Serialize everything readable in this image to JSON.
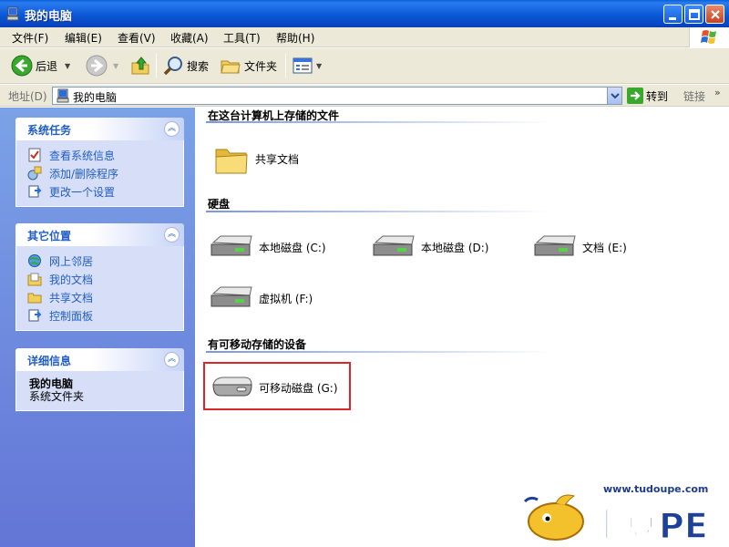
{
  "window": {
    "title": "我的电脑"
  },
  "menu": [
    "文件(F)",
    "编辑(E)",
    "查看(V)",
    "收藏(A)",
    "工具(T)",
    "帮助(H)"
  ],
  "toolbar": {
    "back": "后退",
    "search": "搜索",
    "folders": "文件夹"
  },
  "address": {
    "label": "地址(D)",
    "value": "我的电脑",
    "go": "转到",
    "links": "链接"
  },
  "left": {
    "system_tasks": {
      "title": "系统任务",
      "items": [
        "查看系统信息",
        "添加/删除程序",
        "更改一个设置"
      ]
    },
    "other_places": {
      "title": "其它位置",
      "items": [
        "网上邻居",
        "我的文档",
        "共享文档",
        "控制面板"
      ]
    },
    "details": {
      "title": "详细信息",
      "name": "我的电脑",
      "type": "系统文件夹"
    }
  },
  "sections": {
    "files": {
      "title": "在这台计算机上存储的文件",
      "items": [
        "共享文档"
      ]
    },
    "drives": {
      "title": "硬盘",
      "items": [
        "本地磁盘 (C:)",
        "本地磁盘 (D:)",
        "文档 (E:)",
        "虚拟机 (F:)"
      ]
    },
    "removable": {
      "title": "有可移动存储的设备",
      "items": [
        "可移动磁盘 (G:)"
      ]
    }
  },
  "watermark": {
    "url": "www.tudoupe.com",
    "brand": "土豆PE"
  }
}
